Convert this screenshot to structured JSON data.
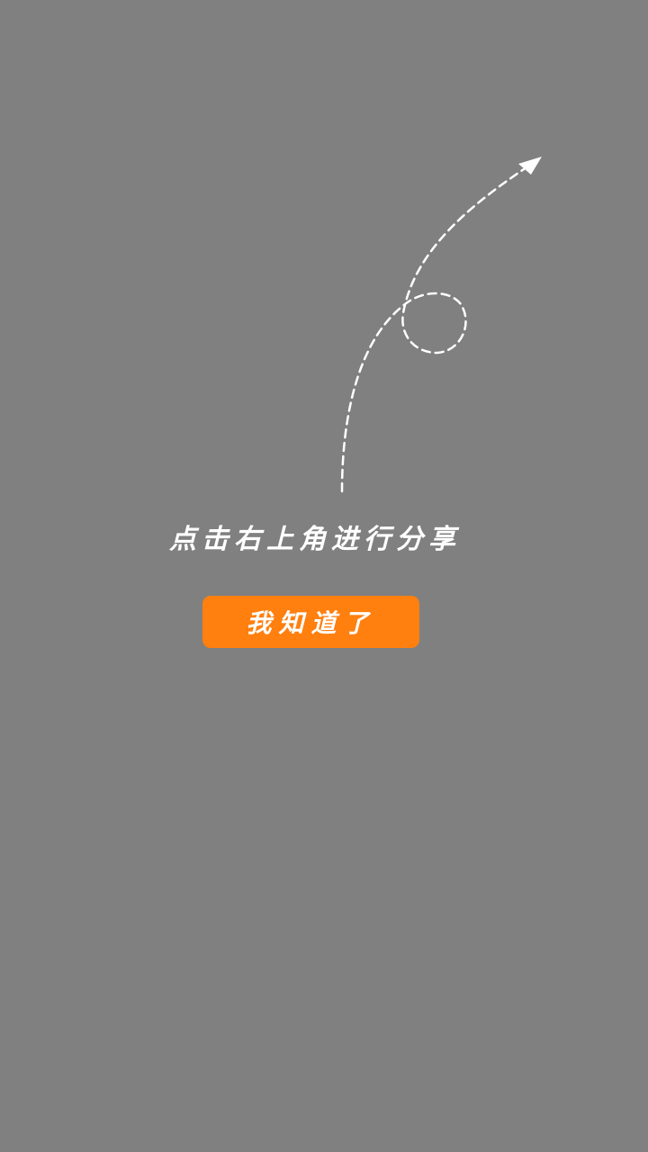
{
  "overlay": {
    "background_color": "#808080",
    "guide_color": "#ffffff",
    "guide_icon": "dashed-curved-arrow-with-loop"
  },
  "hint": {
    "text": "点击右上角进行分享"
  },
  "button": {
    "label": "我知道了",
    "color": "#ff7f0f"
  }
}
